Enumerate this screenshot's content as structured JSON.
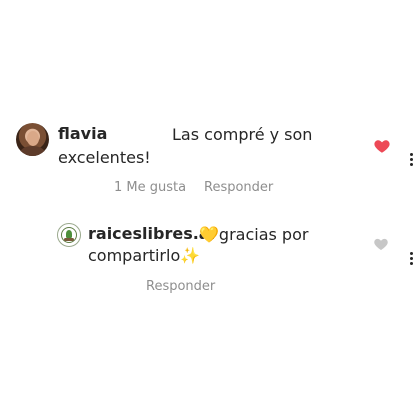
{
  "comments": [
    {
      "username": "flavia",
      "text_line1": "Las compré y son",
      "text_line2": "excelentes!",
      "likes": "1 Me gusta",
      "reply_label": "Responder",
      "liked": true,
      "avatar_icon": "user-photo"
    },
    {
      "username": "raiceslibres.ar",
      "text_line1": "💛gracias por",
      "text_line2": "compartirlo✨",
      "reply_label": "Responder",
      "liked": false,
      "avatar_icon": "brand-logo"
    }
  ],
  "icons": {
    "like_filled": "heart-filled-icon",
    "like_empty": "heart-outline-icon",
    "more": "more-vertical-icon"
  },
  "colors": {
    "like_red": "#ed4956",
    "like_grey": "#c7c7c7",
    "meta_text": "#8e8e8e"
  }
}
